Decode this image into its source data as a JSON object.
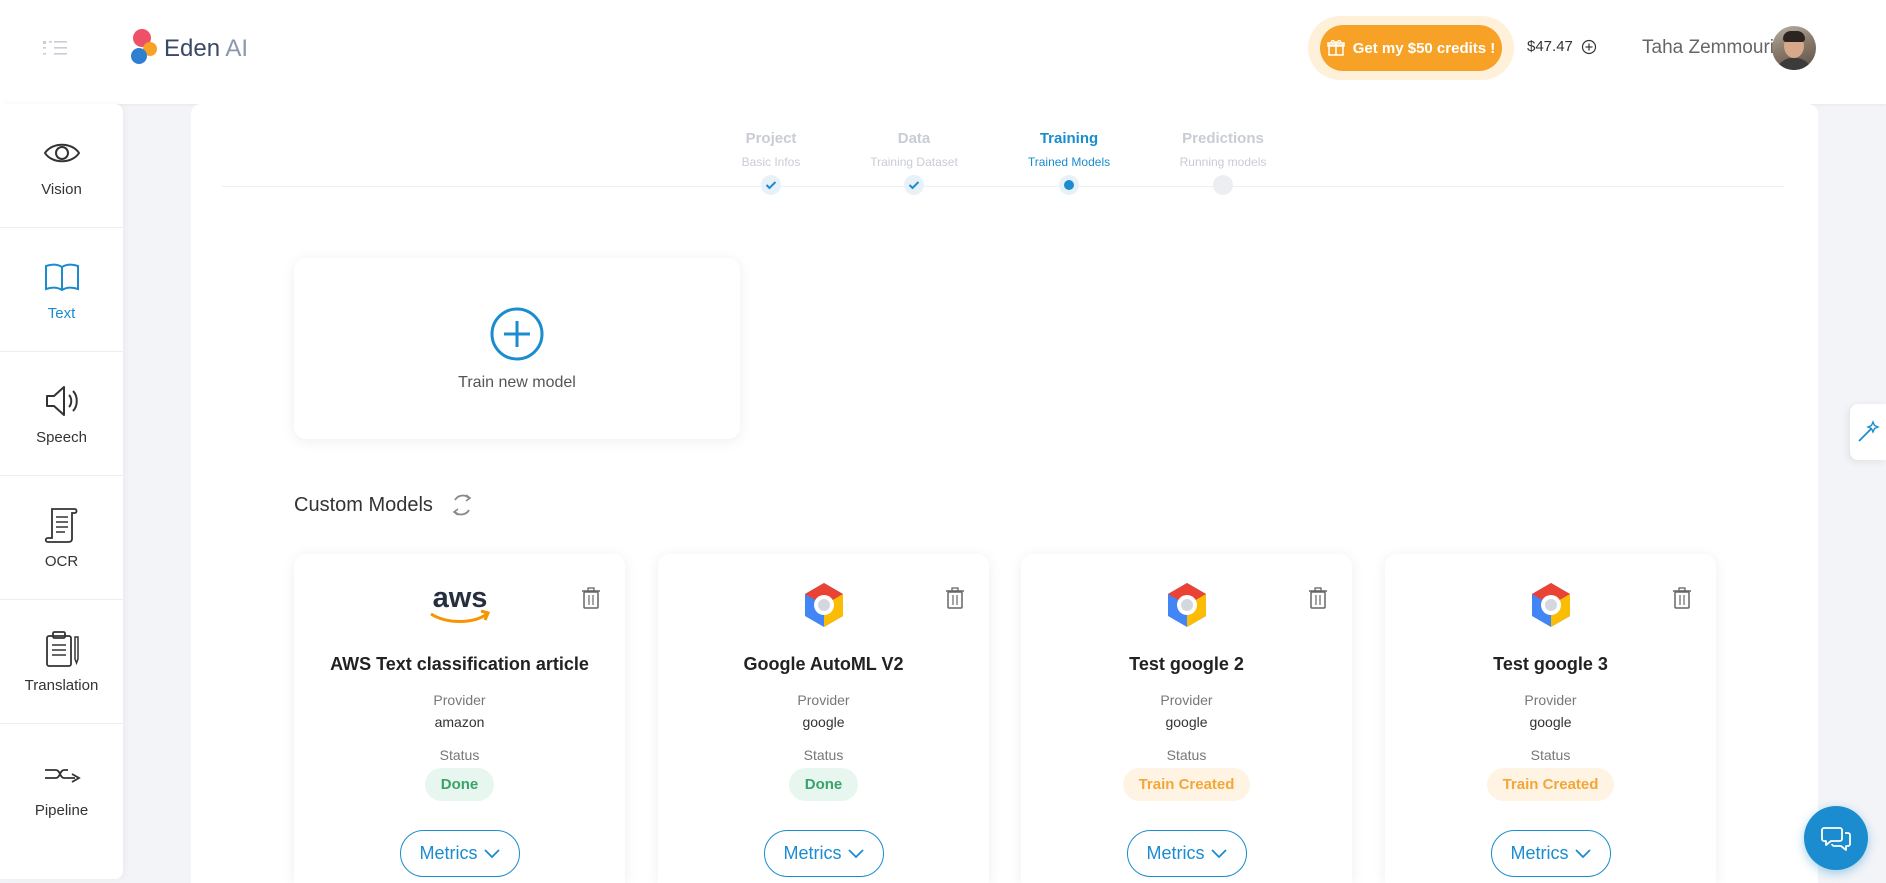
{
  "header": {
    "brand": "Eden",
    "brand_suffix": "AI",
    "credits_button": "Get my $50 credits !",
    "balance": "$47.47",
    "user_name": "Taha Zemmouri"
  },
  "sidebar": {
    "items": [
      {
        "label": "Vision",
        "icon": "eye-icon"
      },
      {
        "label": "Text",
        "icon": "book-icon",
        "active": true
      },
      {
        "label": "Speech",
        "icon": "speaker-icon"
      },
      {
        "label": "OCR",
        "icon": "scroll-icon"
      },
      {
        "label": "Translation",
        "icon": "clipboard-icon"
      },
      {
        "label": "Pipeline",
        "icon": "pipeline-icon"
      }
    ]
  },
  "stepper": {
    "steps": [
      {
        "title": "Project",
        "subtitle": "Basic Infos",
        "state": "completed"
      },
      {
        "title": "Data",
        "subtitle": "Training Dataset",
        "state": "completed"
      },
      {
        "title": "Training",
        "subtitle": "Trained Models",
        "state": "active"
      },
      {
        "title": "Predictions",
        "subtitle": "Running models",
        "state": "upcoming"
      }
    ]
  },
  "train_card": {
    "label": "Train new model"
  },
  "custom_models": {
    "title": "Custom Models",
    "provider_label": "Provider",
    "status_label": "Status",
    "metrics_label": "Metrics",
    "items": [
      {
        "name": "AWS Text classification article",
        "provider": "amazon",
        "status": "Done",
        "status_color": "#3aa36a"
      },
      {
        "name": "Google AutoML V2",
        "provider": "google",
        "status": "Done",
        "status_color": "#3aa36a"
      },
      {
        "name": "Test google 2",
        "provider": "google",
        "status": "Train Created",
        "status_color": "#f3a73b"
      },
      {
        "name": "Test google 3",
        "provider": "google",
        "status": "Train Created",
        "status_color": "#f3a73b"
      }
    ]
  },
  "colors": {
    "accent": "#1a8ccf",
    "credits": "#f7a126"
  }
}
